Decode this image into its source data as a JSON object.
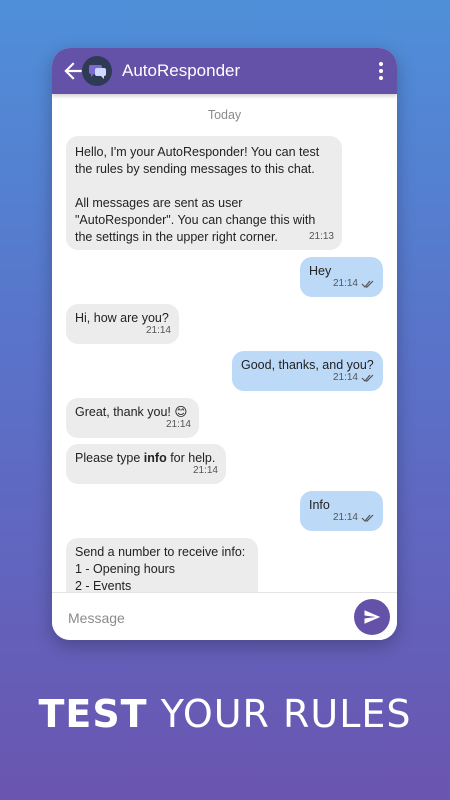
{
  "app": {
    "title": "AutoResponder"
  },
  "chat": {
    "date_label": "Today",
    "messages": [
      {
        "dir": "in",
        "text": "Hello, I'm your AutoResponder! You can test the rules by sending messages to this chat.\n\nAll messages are sent as user \"AutoResponder\". You can change this with the settings in the upper right corner.",
        "time": "21:13"
      },
      {
        "dir": "out",
        "text": "Hey",
        "time": "21:14"
      },
      {
        "dir": "in",
        "text": "Hi, how are you?",
        "time": "21:14"
      },
      {
        "dir": "out",
        "text": "Good, thanks, and you?",
        "time": "21:14"
      },
      {
        "dir": "in",
        "text": "Great, thank you! 😊",
        "time": "21:14"
      },
      {
        "dir": "in",
        "text_before": "Please type ",
        "text_bold": "info",
        "text_after": " for help.",
        "time": "21:14"
      },
      {
        "dir": "out",
        "text": "Info",
        "time": "21:14"
      },
      {
        "dir": "in",
        "text": "Send a number to receive info:\n1 - Opening hours\n2 - Events"
      }
    ]
  },
  "composer": {
    "placeholder": "Message"
  },
  "caption": {
    "bold": "TEST",
    "rest": " YOUR RULES"
  },
  "colors": {
    "appbar": "#6451a8",
    "incoming": "#ececec",
    "outgoing": "#bcd9f8",
    "send": "#6451a8"
  }
}
